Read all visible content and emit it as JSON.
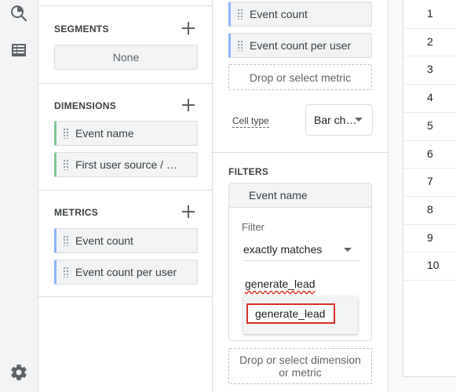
{
  "segments": {
    "title": "SEGMENTS",
    "placeholder": "None"
  },
  "dimensions": {
    "title": "DIMENSIONS",
    "items": [
      {
        "label": "Event name"
      },
      {
        "label": "First user source / …"
      }
    ]
  },
  "metrics": {
    "title": "METRICS",
    "items": [
      {
        "label": "Event count"
      },
      {
        "label": "Event count per user"
      }
    ]
  },
  "values": {
    "items": [
      {
        "label": "Event count"
      },
      {
        "label": "Event count per user"
      }
    ],
    "dropzone": "Drop or select metric"
  },
  "cell_type": {
    "label": "Cell type",
    "value": "Bar ch…"
  },
  "filters": {
    "title": "FILTERS",
    "chip_label": "Event name",
    "panel": {
      "label": "Filter",
      "match_type": "exactly matches",
      "input_value": "generate_lead",
      "suggestion": "generate_lead"
    },
    "dropzone": "Drop or select dimension or metric"
  },
  "table": {
    "rows": [
      "1",
      "2",
      "3",
      "4",
      "5",
      "6",
      "7",
      "8",
      "9",
      "10"
    ]
  },
  "colors": {
    "accent_blue": "#1a73e8",
    "highlight_red": "#d93025"
  },
  "icons": [
    "explore-icon",
    "table-icon",
    "settings-gear-icon",
    "chevron-down-icon",
    "add-icon",
    "drag-handle-icon"
  ]
}
